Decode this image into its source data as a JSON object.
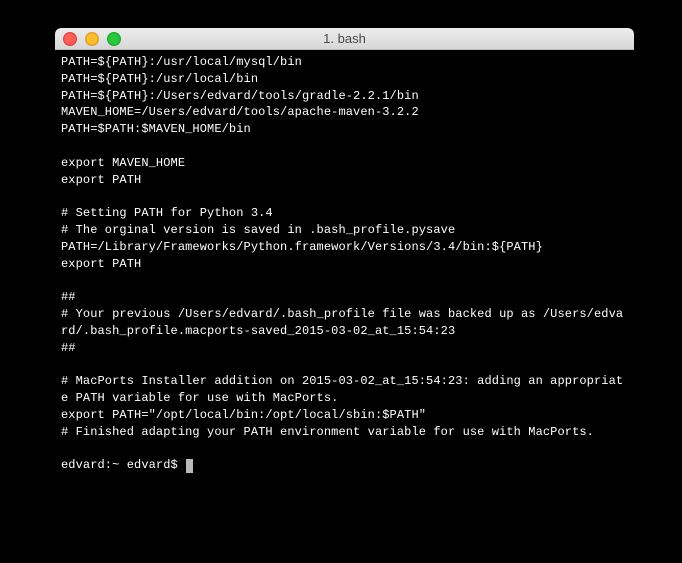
{
  "window": {
    "title": "1. bash"
  },
  "terminal": {
    "lines": [
      "PATH=${PATH}:/usr/local/mysql/bin",
      "PATH=${PATH}:/usr/local/bin",
      "PATH=${PATH}:/Users/edvard/tools/gradle-2.2.1/bin",
      "MAVEN_HOME=/Users/edvard/tools/apache-maven-3.2.2",
      "PATH=$PATH:$MAVEN_HOME/bin",
      "",
      "export MAVEN_HOME",
      "export PATH",
      "",
      "# Setting PATH for Python 3.4",
      "# The orginal version is saved in .bash_profile.pysave",
      "PATH=/Library/Frameworks/Python.framework/Versions/3.4/bin:${PATH}",
      "export PATH",
      "",
      "##",
      "# Your previous /Users/edvard/.bash_profile file was backed up as /Users/edvard/.bash_profile.macports-saved_2015-03-02_at_15:54:23",
      "##",
      "",
      "# MacPorts Installer addition on 2015-03-02_at_15:54:23: adding an appropriate PATH variable for use with MacPorts.",
      "export PATH=\"/opt/local/bin:/opt/local/sbin:$PATH\"",
      "# Finished adapting your PATH environment variable for use with MacPorts.",
      ""
    ],
    "prompt": "edvard:~ edvard$ "
  }
}
